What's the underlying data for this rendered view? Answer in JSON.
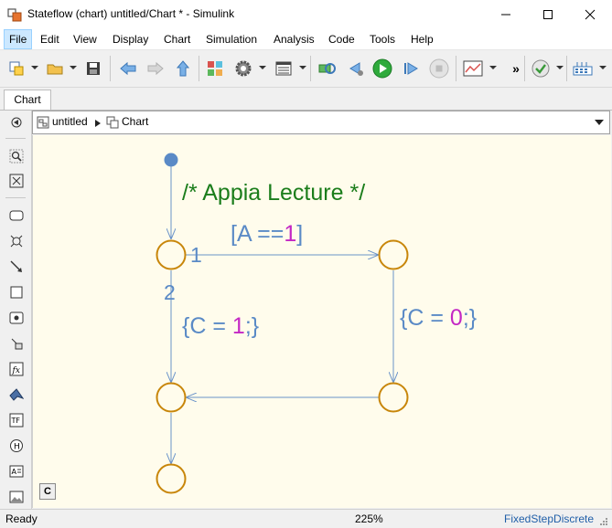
{
  "window": {
    "title": "Stateflow (chart) untitled/Chart * - Simulink"
  },
  "menu": {
    "items": [
      "File",
      "Edit",
      "View",
      "Display",
      "Chart",
      "Simulation",
      "Analysis",
      "Code",
      "Tools",
      "Help"
    ],
    "active": "File"
  },
  "toolbar": {
    "overflow": "»"
  },
  "tabs": {
    "active": "Chart"
  },
  "address": {
    "root": "untitled",
    "current": "Chart"
  },
  "chart": {
    "comment": "/* Appia Lecture */",
    "t1_order": "1",
    "t2_order": "2",
    "t1_guard_prefix": "[A ==",
    "t1_guard_value": "1",
    "t1_guard_suffix": "]",
    "t2_action_prefix": "{C = ",
    "t2_action_value": "1",
    "t2_action_suffix": ";}",
    "t3_action_prefix": "{C = ",
    "t3_action_value": "0",
    "t3_action_suffix": ";}",
    "c_button": "C",
    "colors": {
      "state": "#c8860a",
      "transition": "#6a93c9",
      "label": "#5a8ac6",
      "number": "#c427c4",
      "comment": "#1b7d1b",
      "canvas": "#fffcec"
    }
  },
  "status": {
    "state": "Ready",
    "zoom": "225%",
    "solver": "FixedStepDiscrete"
  }
}
